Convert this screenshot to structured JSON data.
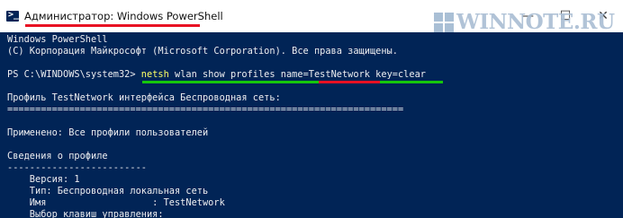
{
  "window": {
    "title": "Администратор: Windows PowerShell",
    "icon": "powershell-icon",
    "controls": {
      "minimize": "—",
      "maximize": "☐",
      "close": "✕"
    }
  },
  "watermark": {
    "text": "WINNOTE.RU",
    "icon": "windows-logo-icon"
  },
  "colors": {
    "console_bg": "#012456",
    "console_fg": "#eeedf0",
    "title_underline": "#e81123",
    "highlight_green": "#16c60c",
    "highlight_red": "#e81123",
    "command_keyword": "#ffff66"
  },
  "console": {
    "lines": [
      "Windows PowerShell",
      "(C) Корпорация Майкрософт (Microsoft Corporation). Все права защищены.",
      "",
      "",
      "",
      "Профиль TestNetwork интерфейса Беспроводная сеть:",
      "=======================================================================",
      "",
      "Применено: Все профили пользователей",
      "",
      "Сведения о профиле",
      "-------------------------",
      "    Версия: 1",
      "    Тип: Беспроводная локальная сеть",
      "    Имя                   : TestNetwork",
      "    Выбор клавиш управления:"
    ],
    "prompt": "PS C:\\WINDOWS\\system32> ",
    "command_keyword": "netsh",
    "command_args": " wlan show profiles name=TestNetwork key=clear"
  }
}
